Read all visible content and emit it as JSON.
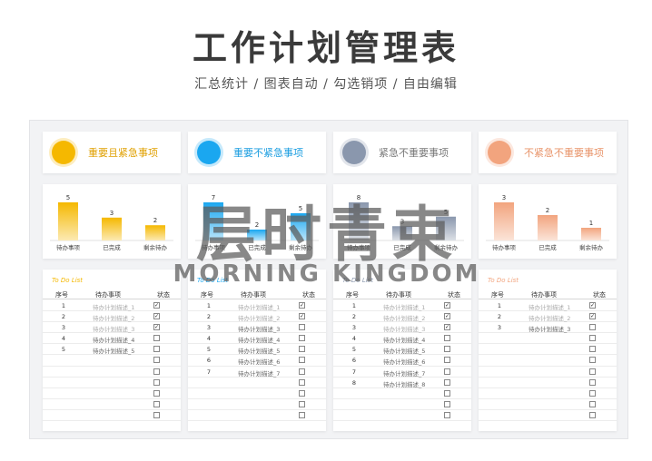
{
  "title": "工作计划管理表",
  "subtitle": "汇总统计 / 图表自动 / 勾选销项 / 自由编辑",
  "watermark": {
    "cn": "层时青束",
    "en": "MORNING KINGDOM"
  },
  "list_header": {
    "title": "To Do List",
    "no": "序号",
    "task": "待办事项",
    "status": "状态"
  },
  "quadrants": [
    {
      "name": "重要且紧急事项",
      "color": "#f5b800",
      "label_color": "#e0a000",
      "chart_data": {
        "type": "bar",
        "categories": [
          "待办事项",
          "已完成",
          "剩余待办"
        ],
        "values": [
          5,
          3,
          2
        ]
      },
      "items": [
        {
          "no": "1",
          "task": "待办计划描述_1",
          "done": true
        },
        {
          "no": "2",
          "task": "待办计划描述_2",
          "done": true
        },
        {
          "no": "3",
          "task": "待办计划描述_3",
          "done": true
        },
        {
          "no": "4",
          "task": "待办计划描述_4",
          "done": false
        },
        {
          "no": "5",
          "task": "待办计划描述_5",
          "done": false
        },
        {
          "no": "",
          "task": "",
          "done": false
        },
        {
          "no": "",
          "task": "",
          "done": false
        },
        {
          "no": "",
          "task": "",
          "done": false
        },
        {
          "no": "",
          "task": "",
          "done": false
        },
        {
          "no": "",
          "task": "",
          "done": false
        },
        {
          "no": "",
          "task": "",
          "done": false
        }
      ]
    },
    {
      "name": "重要不紧急事项",
      "color": "#1aa7f0",
      "label_color": "#1a9de0",
      "chart_data": {
        "type": "bar",
        "categories": [
          "待办事项",
          "已完成",
          "剩余待办"
        ],
        "values": [
          7,
          2,
          5
        ]
      },
      "items": [
        {
          "no": "1",
          "task": "待办计划描述_1",
          "done": true
        },
        {
          "no": "2",
          "task": "待办计划描述_2",
          "done": true
        },
        {
          "no": "3",
          "task": "待办计划描述_3",
          "done": false
        },
        {
          "no": "4",
          "task": "待办计划描述_4",
          "done": false
        },
        {
          "no": "5",
          "task": "待办计划描述_5",
          "done": false
        },
        {
          "no": "6",
          "task": "待办计划描述_6",
          "done": false
        },
        {
          "no": "7",
          "task": "待办计划描述_7",
          "done": false
        },
        {
          "no": "",
          "task": "",
          "done": false
        },
        {
          "no": "",
          "task": "",
          "done": false
        },
        {
          "no": "",
          "task": "",
          "done": false
        },
        {
          "no": "",
          "task": "",
          "done": false
        }
      ]
    },
    {
      "name": "紧急不重要事项",
      "color": "#8a97ad",
      "label_color": "#777",
      "chart_data": {
        "type": "bar",
        "categories": [
          "待办事项",
          "已完成",
          "剩余待办"
        ],
        "values": [
          8,
          3,
          5
        ]
      },
      "items": [
        {
          "no": "1",
          "task": "待办计划描述_1",
          "done": true
        },
        {
          "no": "2",
          "task": "待办计划描述_2",
          "done": true
        },
        {
          "no": "3",
          "task": "待办计划描述_3",
          "done": true
        },
        {
          "no": "4",
          "task": "待办计划描述_4",
          "done": false
        },
        {
          "no": "5",
          "task": "待办计划描述_5",
          "done": false
        },
        {
          "no": "6",
          "task": "待办计划描述_6",
          "done": false
        },
        {
          "no": "7",
          "task": "待办计划描述_7",
          "done": false
        },
        {
          "no": "8",
          "task": "待办计划描述_8",
          "done": false
        },
        {
          "no": "",
          "task": "",
          "done": false
        },
        {
          "no": "",
          "task": "",
          "done": false
        },
        {
          "no": "",
          "task": "",
          "done": false
        }
      ]
    },
    {
      "name": "不紧急不重要事项",
      "color": "#f2a47e",
      "label_color": "#e8946a",
      "chart_data": {
        "type": "bar",
        "categories": [
          "待办事项",
          "已完成",
          "剩余待办"
        ],
        "values": [
          3,
          2,
          1
        ]
      },
      "items": [
        {
          "no": "1",
          "task": "待办计划描述_1",
          "done": true
        },
        {
          "no": "2",
          "task": "待办计划描述_2",
          "done": true
        },
        {
          "no": "3",
          "task": "待办计划描述_3",
          "done": false
        },
        {
          "no": "",
          "task": "",
          "done": false
        },
        {
          "no": "",
          "task": "",
          "done": false
        },
        {
          "no": "",
          "task": "",
          "done": false
        },
        {
          "no": "",
          "task": "",
          "done": false
        },
        {
          "no": "",
          "task": "",
          "done": false
        },
        {
          "no": "",
          "task": "",
          "done": false
        },
        {
          "no": "",
          "task": "",
          "done": false
        },
        {
          "no": "",
          "task": "",
          "done": false
        }
      ]
    }
  ]
}
